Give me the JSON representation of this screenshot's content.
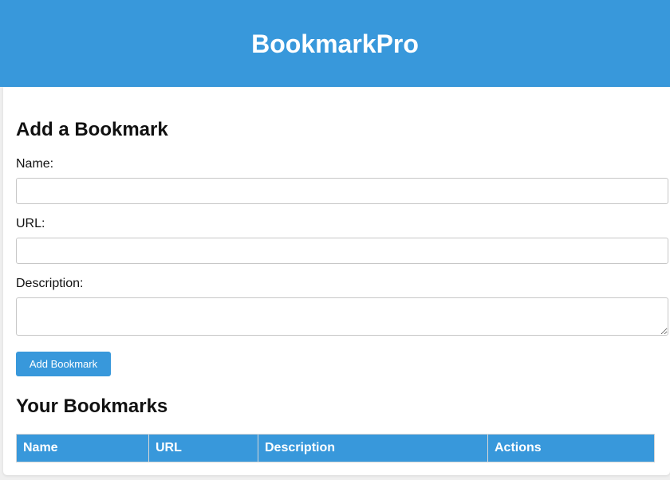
{
  "header": {
    "title": "BookmarkPro"
  },
  "form": {
    "heading": "Add a Bookmark",
    "name_label": "Name:",
    "name_value": "",
    "url_label": "URL:",
    "url_value": "",
    "description_label": "Description:",
    "description_value": "",
    "submit_label": "Add Bookmark"
  },
  "bookmarks": {
    "heading": "Your Bookmarks",
    "columns": [
      "Name",
      "URL",
      "Description",
      "Actions"
    ],
    "rows": []
  },
  "colors": {
    "accent": "#3898db",
    "background": "#efefef",
    "card": "#ffffff",
    "border": "#c7c7c7"
  }
}
